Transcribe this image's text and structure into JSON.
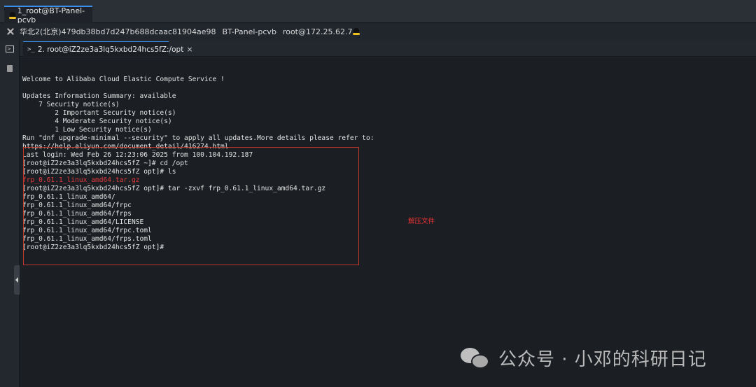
{
  "window_tab": {
    "title": "1_root@BT-Panel-pcvb"
  },
  "info_bar": {
    "region_id": "华北2(北京)479db38bd7d247b688dcaac81904ae98",
    "host": "BT-Panel-pcvb",
    "user_ip": "root@172.25.62.7"
  },
  "terminal_tab": {
    "prompt_glyph": ">_",
    "title": "2. root@iZ2ze3a3lq5kxbd24hcs5fZ:/opt",
    "close": "×"
  },
  "terminal": {
    "lines": [
      {
        "text": ""
      },
      {
        "text": "Welcome to Alibaba Cloud Elastic Compute Service !"
      },
      {
        "text": ""
      },
      {
        "text": "Updates Information Summary: available"
      },
      {
        "text": "    7 Security notice(s)"
      },
      {
        "text": "        2 Important Security notice(s)"
      },
      {
        "text": "        4 Moderate Security notice(s)"
      },
      {
        "text": "        1 Low Security notice(s)"
      },
      {
        "text": "Run \"dnf upgrade-minimal --security\" to apply all updates.More details please refer to:"
      },
      {
        "text": "https://help.aliyun.com/document_detail/416274.html"
      },
      {
        "text": "Last login: Wed Feb 26 12:23:06 2025 from 100.104.192.187"
      },
      {
        "text": "[root@iZ2ze3a3lq5kxbd24hcs5fZ ~]# cd /opt"
      },
      {
        "text": "[root@iZ2ze3a3lq5kxbd24hcs5fZ opt]# ls"
      },
      {
        "text": "frp_0.61.1_linux_amd64.tar.gz",
        "color": "red"
      },
      {
        "text": "[root@iZ2ze3a3lq5kxbd24hcs5fZ opt]# tar -zxvf frp_0.61.1_linux_amd64.tar.gz"
      },
      {
        "text": "frp_0.61.1_linux_amd64/"
      },
      {
        "text": "frp_0.61.1_linux_amd64/frpc"
      },
      {
        "text": "frp_0.61.1_linux_amd64/frps"
      },
      {
        "text": "frp_0.61.1_linux_amd64/LICENSE"
      },
      {
        "text": "frp_0.61.1_linux_amd64/frpc.toml"
      },
      {
        "text": "frp_0.61.1_linux_amd64/frps.toml"
      },
      {
        "text": "[root@iZ2ze3a3lq5kxbd24hcs5fZ opt]#"
      }
    ]
  },
  "annotation": {
    "text": "解压文件",
    "color": "#ee3333"
  },
  "watermark": {
    "text": "公众号 · 小邓的科研日记",
    "icon": "wechat-icon"
  },
  "colors": {
    "accent": "#3b8eea",
    "background": "#1b1e23",
    "highlight": "#c0392b",
    "ls_archive": "#e23b3b"
  }
}
